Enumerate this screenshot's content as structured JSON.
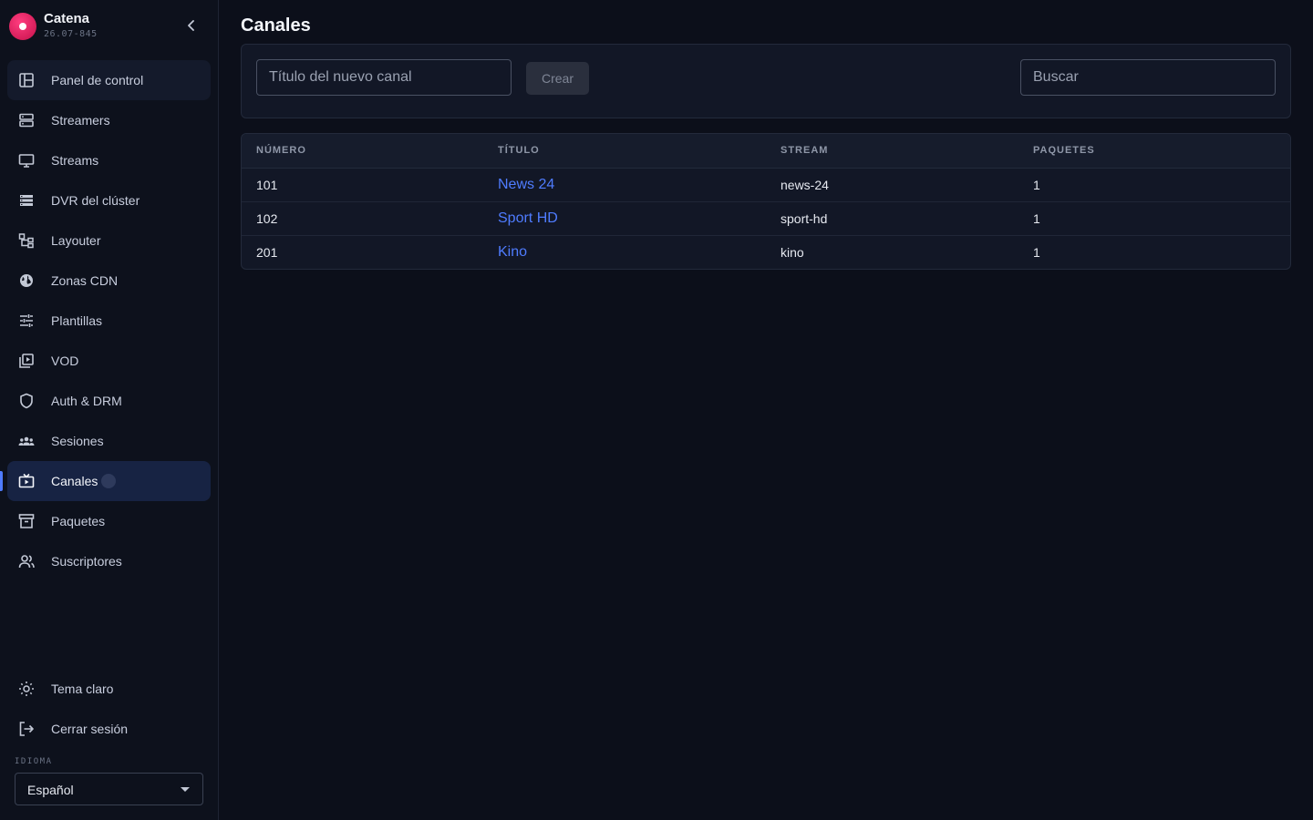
{
  "app": {
    "name": "Catena",
    "version": "26.07-845"
  },
  "sidebar": {
    "items": [
      {
        "label": "Panel de control",
        "icon": "dashboard-icon"
      },
      {
        "label": "Streamers",
        "icon": "server-icon"
      },
      {
        "label": "Streams",
        "icon": "monitor-icon"
      },
      {
        "label": "DVR del clúster",
        "icon": "storage-icon"
      },
      {
        "label": "Layouter",
        "icon": "layout-tree-icon"
      },
      {
        "label": "Zonas CDN",
        "icon": "globe-icon"
      },
      {
        "label": "Plantillas",
        "icon": "sliders-icon"
      },
      {
        "label": "VOD",
        "icon": "video-library-icon"
      },
      {
        "label": "Auth & DRM",
        "icon": "shield-icon"
      },
      {
        "label": "Sesiones",
        "icon": "group-icon"
      },
      {
        "label": "Canales",
        "icon": "tv-icon"
      },
      {
        "label": "Paquetes",
        "icon": "archive-icon"
      },
      {
        "label": "Suscriptores",
        "icon": "users-icon"
      }
    ],
    "active": "Canales",
    "bottom": [
      {
        "label": "Tema claro",
        "icon": "sun-icon"
      },
      {
        "label": "Cerrar sesión",
        "icon": "logout-icon"
      }
    ],
    "language": {
      "label": "IDIOMA",
      "selected": "Español"
    }
  },
  "main": {
    "title": "Canales",
    "new_channel_placeholder": "Título del nuevo canal",
    "create_label": "Crear",
    "search_placeholder": "Buscar",
    "table": {
      "columns": [
        "NÚMERO",
        "TÍTULO",
        "STREAM",
        "PAQUETES"
      ],
      "rows": [
        {
          "number": "101",
          "title": "News 24",
          "stream": "news-24",
          "packages": "1"
        },
        {
          "number": "102",
          "title": "Sport HD",
          "stream": "sport-hd",
          "packages": "1"
        },
        {
          "number": "201",
          "title": "Kino",
          "stream": "kino",
          "packages": "1"
        }
      ]
    }
  },
  "colors": {
    "accent": "#4f7cff",
    "brand": "#e2145a",
    "background": "#0c0f1a",
    "active_nav": "#172343"
  }
}
